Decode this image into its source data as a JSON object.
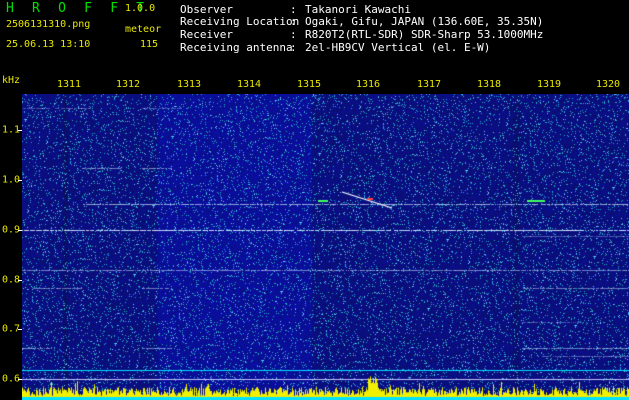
{
  "header": {
    "app_name": "H R O F F T",
    "version": "1.0.0",
    "filename": "2506131310.png",
    "mode_label": "meteor",
    "datetime": "25.06.13 13:10",
    "meteor_count": "115"
  },
  "info": [
    {
      "key": "Observer",
      "sep": ":",
      "value": "Takanori Kawachi"
    },
    {
      "key": "Receiving Location",
      "sep": ":",
      "value": "Ogaki, Gifu, JAPAN (136.60E, 35.35N)"
    },
    {
      "key": "Receiver",
      "sep": ":",
      "value": "R820T2(RTL-SDR) SDR-Sharp 53.1000MHz"
    },
    {
      "key": "Receiving antenna",
      "sep": ":",
      "value": "2el-HB9CV Vertical (el. E-W)"
    }
  ],
  "spectrogram": {
    "y_unit": "kHz",
    "x_ticks": [
      "1311",
      "1312",
      "1313",
      "1314",
      "1315",
      "1316",
      "1317",
      "1318",
      "1319",
      "1320"
    ],
    "y_ticks": [
      "1.1",
      "1.0",
      "0.9",
      "0.8",
      "0.7",
      "0.6"
    ],
    "colors": {
      "background": "#000000",
      "label": "#e8e800",
      "waterfall_base": "#12188c",
      "meteor_trail": "#ffffff",
      "meteor_head": "#ff4040",
      "histogram": "#f0f000",
      "baseline": "#00e0ff"
    }
  }
}
